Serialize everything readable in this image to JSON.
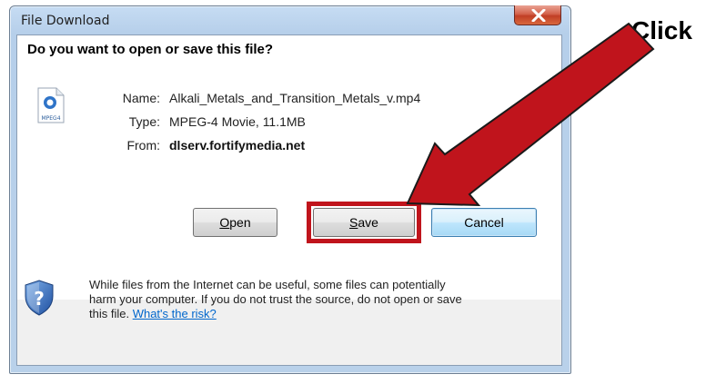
{
  "window": {
    "title": "File Download",
    "close_glyph": "x"
  },
  "dialog": {
    "question": "Do you want to open or save this file?",
    "file_icon": "mpeg4-file-icon",
    "file_icon_label": "MPEG4",
    "fields": {
      "name_label": "Name:",
      "name_value": "Alkali_Metals_and_Transition_Metals_v.mp4",
      "type_label": "Type:",
      "type_value": "MPEG-4 Movie, 11.1MB",
      "from_label": "From:",
      "from_value": "dlserv.fortifymedia.net"
    },
    "buttons": {
      "open_prefix": "",
      "open_mnemonic": "O",
      "open_rest": "pen",
      "save_prefix": "",
      "save_mnemonic": "S",
      "save_rest": "ave",
      "cancel": "Cancel"
    },
    "warning": {
      "text": "While files from the Internet can be useful, some files can potentially harm your computer. If you do not trust the source, do not open or save this file.",
      "link": "What's the risk?"
    }
  },
  "annotation": {
    "label": "Click",
    "arrow_color": "#c0141c",
    "highlight_color": "#c0141c"
  }
}
